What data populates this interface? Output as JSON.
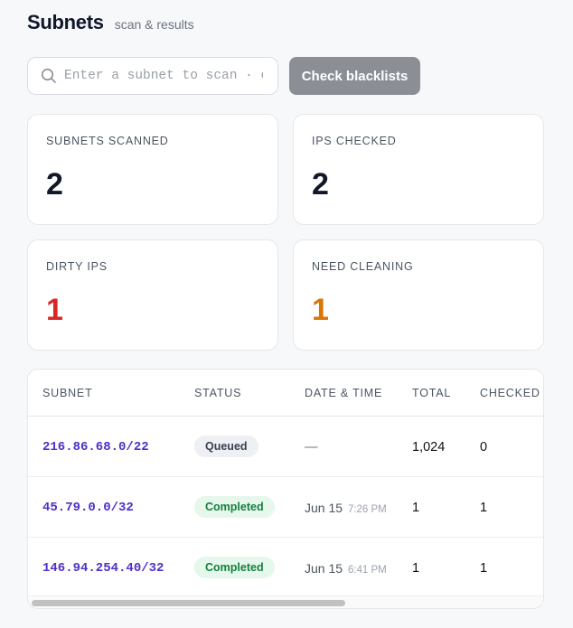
{
  "header": {
    "title": "Subnets",
    "subtitle": "scan & results"
  },
  "search": {
    "placeholder": "Enter a subnet to scan · e",
    "value": ""
  },
  "actions": {
    "check_label": "Check blacklists"
  },
  "stats": [
    {
      "label": "SUBNETS SCANNED",
      "value": "2",
      "color": "#111827"
    },
    {
      "label": "IPS CHECKED",
      "value": "2",
      "color": "#111827"
    },
    {
      "label": "DIRTY IPS",
      "value": "1",
      "color": "#dc2626"
    },
    {
      "label": "NEED CLEANING",
      "value": "1",
      "color": "#d97706"
    }
  ],
  "table": {
    "columns": [
      "SUBNET",
      "STATUS",
      "DATE & TIME",
      "TOTAL",
      "CHECKED"
    ],
    "rows": [
      {
        "subnet": "216.86.68.0/22",
        "status": "Queued",
        "date": "—",
        "time": "",
        "total": "1,024",
        "checked": "0"
      },
      {
        "subnet": "45.79.0.0/32",
        "status": "Completed",
        "date": "Jun 15",
        "time": "7:26 PM",
        "total": "1",
        "checked": "1"
      },
      {
        "subnet": "146.94.254.40/32",
        "status": "Completed",
        "date": "Jun 15",
        "time": "6:41 PM",
        "total": "1",
        "checked": "1"
      }
    ]
  },
  "colors": {
    "accent": "#4f2fc6",
    "button": "#8b8f95",
    "dirty": "#dc2626",
    "cleaning": "#d97706",
    "completed": "#15803d"
  }
}
